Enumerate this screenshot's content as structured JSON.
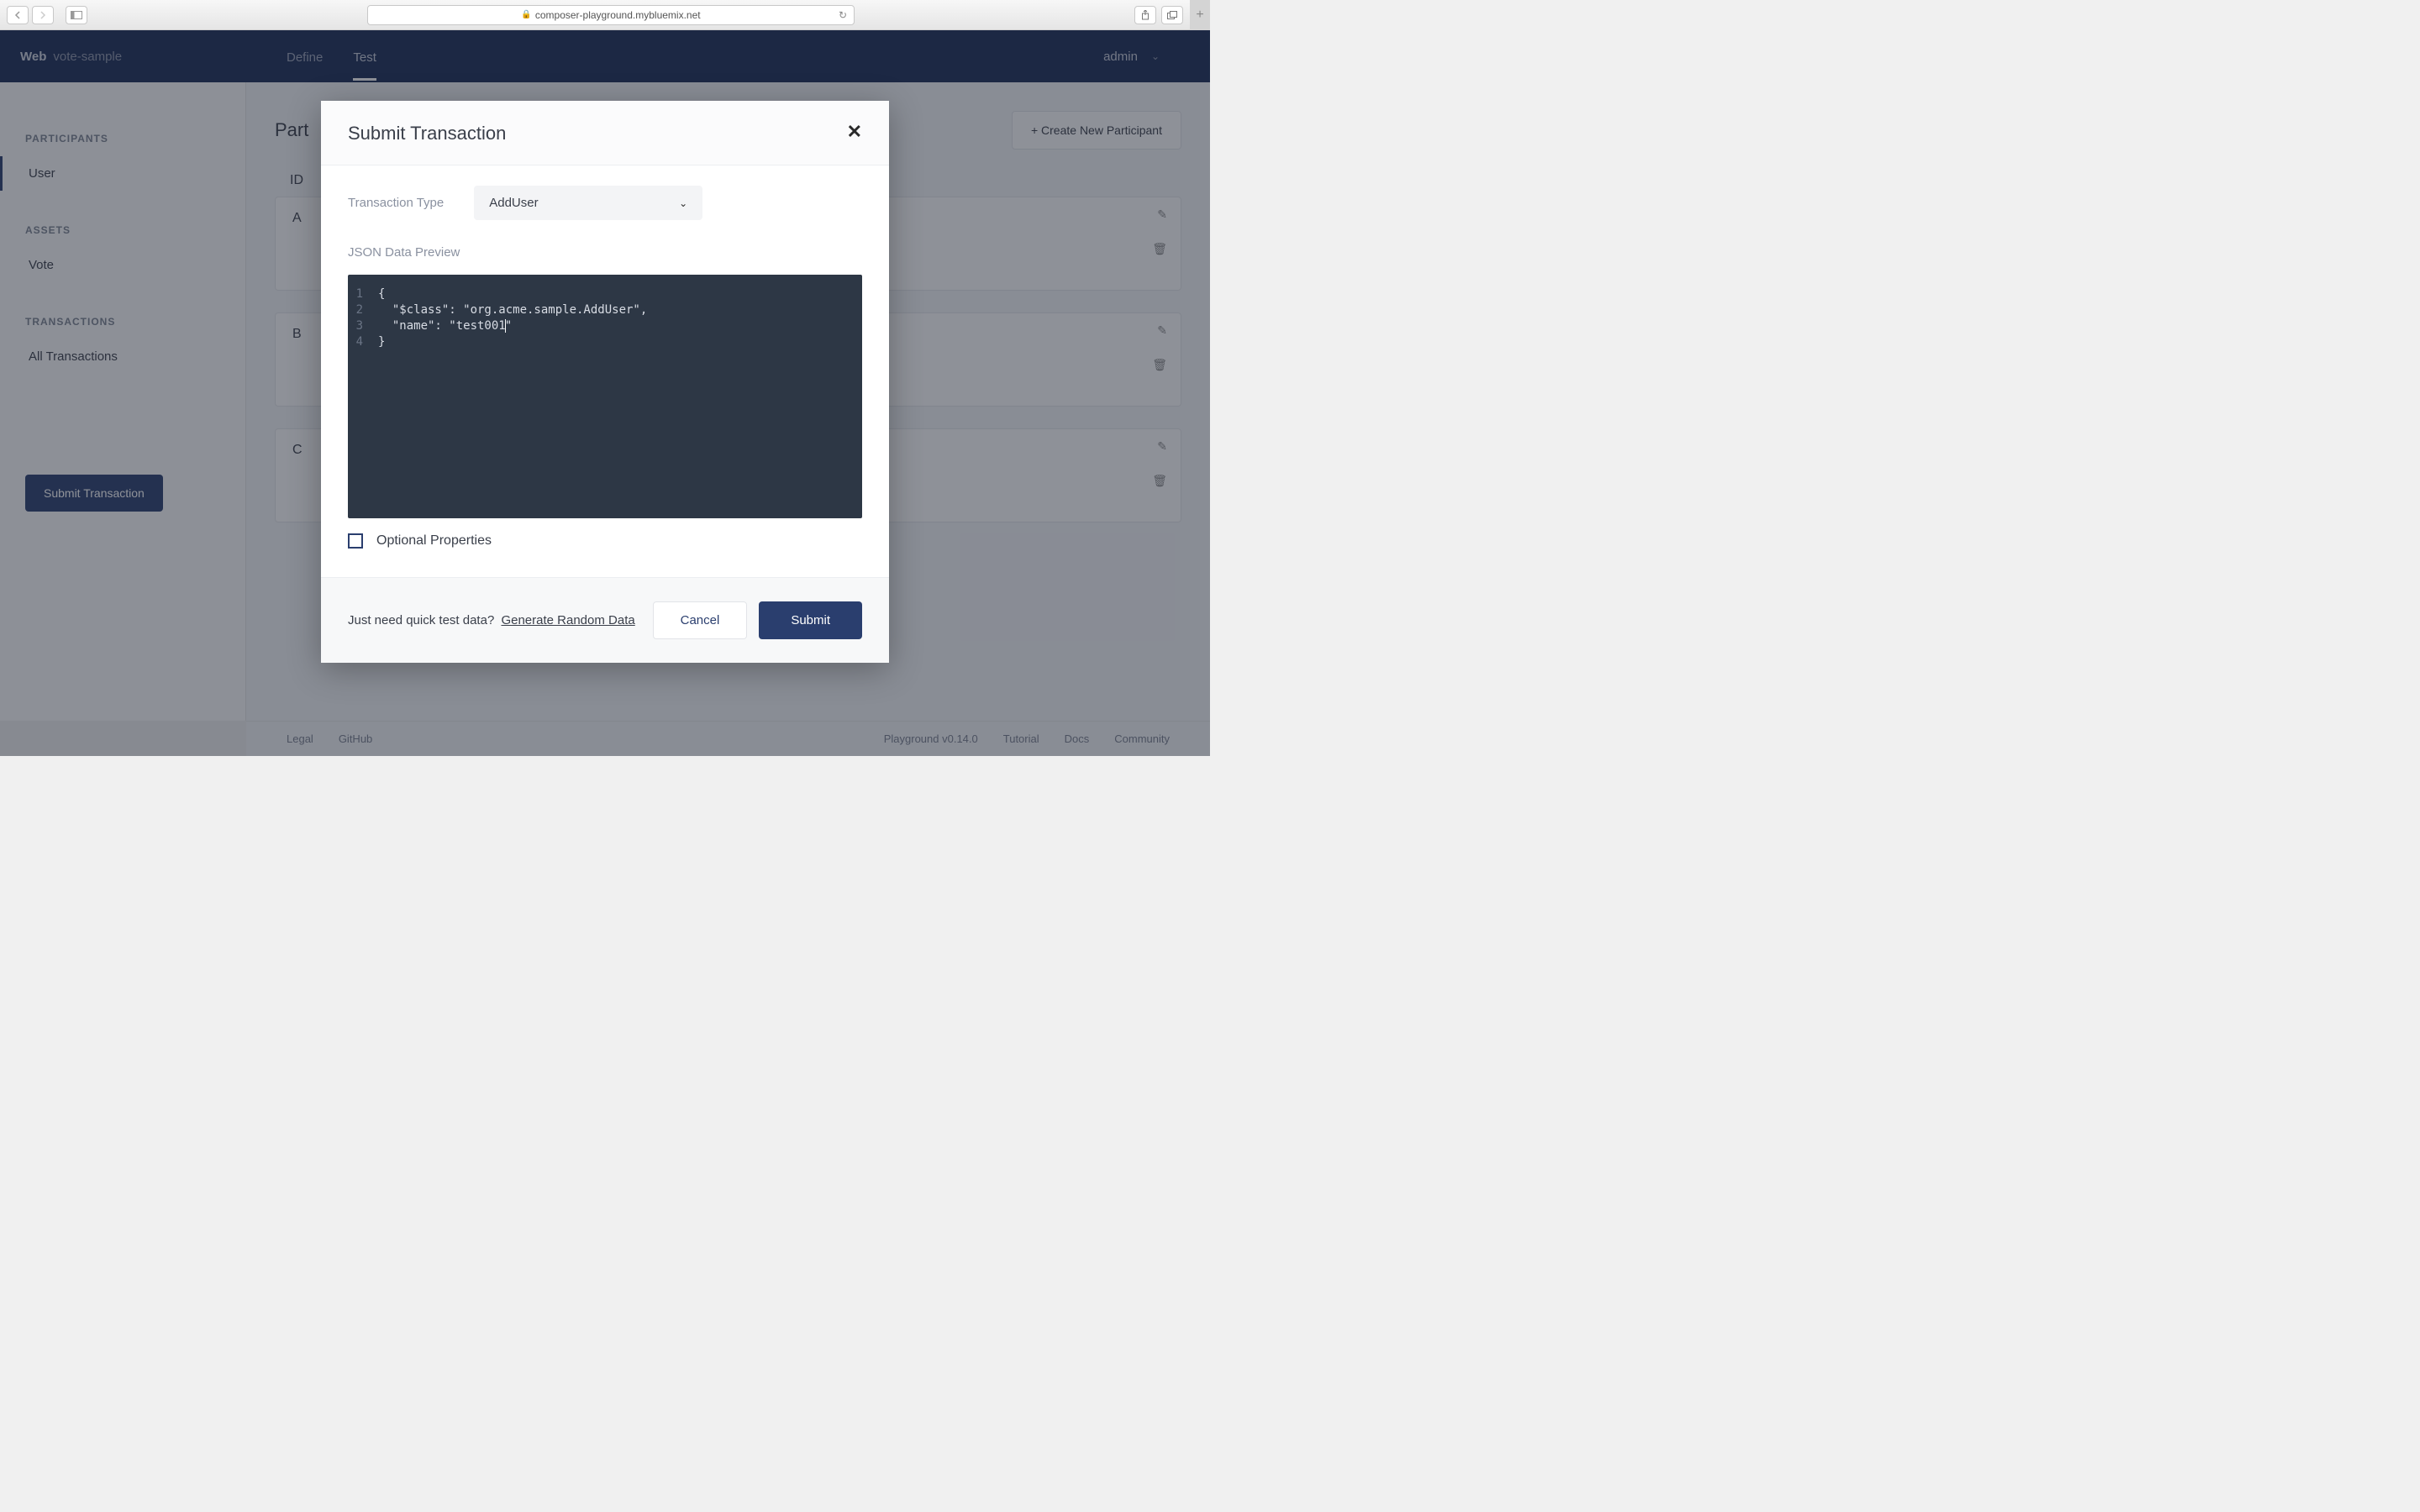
{
  "browser": {
    "url": "composer-playground.mybluemix.net"
  },
  "header": {
    "web": "Web",
    "project": "vote-sample",
    "tabs": [
      "Define",
      "Test"
    ],
    "user": "admin"
  },
  "sidebar": {
    "sections": [
      {
        "heading": "PARTICIPANTS",
        "items": [
          "User"
        ]
      },
      {
        "heading": "ASSETS",
        "items": [
          "Vote"
        ]
      },
      {
        "heading": "TRANSACTIONS",
        "items": [
          "All Transactions"
        ]
      }
    ],
    "submit_button": "Submit Transaction"
  },
  "content": {
    "title": "Part",
    "create_button": "+ Create New Participant",
    "id_label": "ID",
    "cards": [
      "A",
      "B",
      "C"
    ]
  },
  "footer": {
    "left": [
      "Legal",
      "GitHub"
    ],
    "right": [
      "Playground v0.14.0",
      "Tutorial",
      "Docs",
      "Community"
    ]
  },
  "modal": {
    "title": "Submit Transaction",
    "tx_type_label": "Transaction Type",
    "tx_type_value": "AddUser",
    "json_label": "JSON Data Preview",
    "code_lines": [
      "{",
      "  \"$class\": \"org.acme.sample.AddUser\",",
      "  \"name\": \"test001\"",
      "}"
    ],
    "optional_label": "Optional Properties",
    "hint": "Just need quick test data?",
    "hint_link": "Generate Random Data",
    "cancel": "Cancel",
    "submit": "Submit"
  }
}
